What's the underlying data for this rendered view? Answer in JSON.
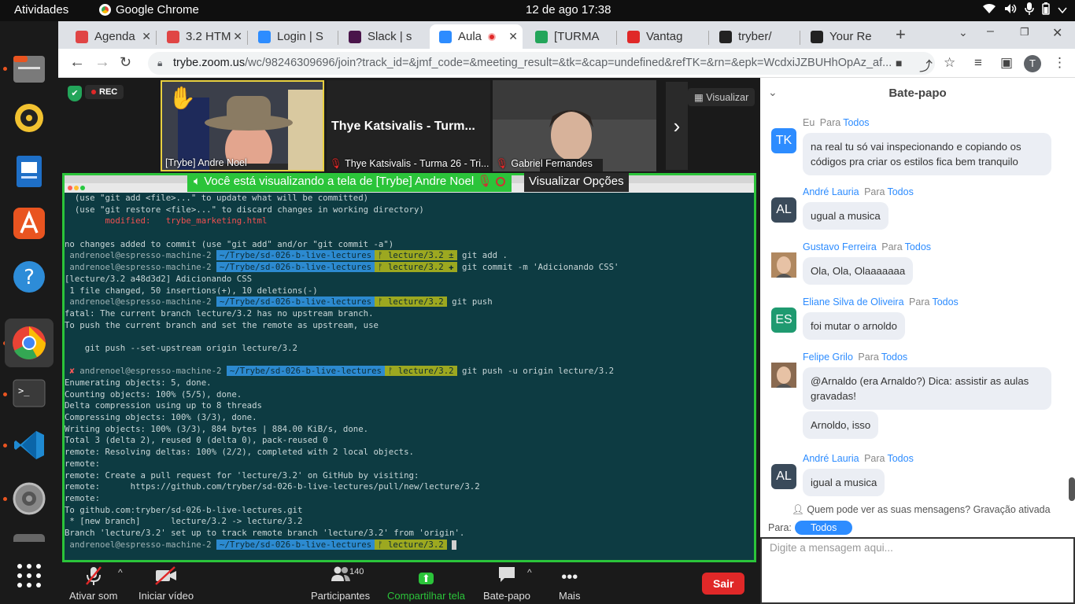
{
  "system": {
    "activities": "Atividades",
    "app_name": "Google Chrome",
    "clock": "12 de ago  17:38"
  },
  "browser": {
    "tabs": [
      {
        "label": "Agenda",
        "color": "#e04545"
      },
      {
        "label": "3.2 HTM",
        "color": "#e04545"
      },
      {
        "label": "Login | S",
        "color": "#2d8cff"
      },
      {
        "label": "Slack | s",
        "color": "#4a154b"
      },
      {
        "label": "Aula",
        "color": "#2d8cff"
      },
      {
        "label": "[TURMA",
        "color": "#23a55a"
      },
      {
        "label": "Vantag",
        "color": "#e02828"
      },
      {
        "label": "tryber/",
        "color": "#222222"
      },
      {
        "label": "Your Re",
        "color": "#222222"
      }
    ],
    "url_host": "trybe.zoom.us",
    "url_path": "/wc/98246309696/join?track_id=&jmf_code=&meeting_result=&tk=&cap=undefined&refTK=&rn=&epk=WcdxiJZBUHhOpAz_af...",
    "profile_initial": "T"
  },
  "meeting": {
    "rec_label": "REC",
    "visualizar_label": "Visualizar",
    "participants": [
      {
        "name": "[Trybe] Andre Noel"
      },
      {
        "name": "Thye Katsivalis - Turma 26 - Tri...",
        "big_label": "Thye Katsivalis - Turm..."
      },
      {
        "name": "Gabriel Fernandes"
      }
    ],
    "share_banner": "Você está visualizando a tela de [Trybe] Andre Noel",
    "view_options": "Visualizar Opções",
    "controls": {
      "mute": "Ativar som",
      "video": "Iniciar vídeo",
      "participants": "Participantes",
      "participants_count": "140",
      "share": "Compartilhar tela",
      "chat": "Bate-papo",
      "more": "Mais",
      "leave": "Sair"
    }
  },
  "terminal": {
    "lines": [
      {
        "text": "  (use \"git add <file>...\" to update what will be committed)"
      },
      {
        "text": "  (use \"git restore <file>...\" to discard changes in working directory)"
      },
      {
        "text": "        modified:   trybe_marketing.html",
        "style": "modified"
      },
      {
        "text": ""
      },
      {
        "text": "no changes added to commit (use \"git add\" and/or \"git commit -a\")"
      },
      {
        "prompt": true,
        "host": " andrenoel@espresso-machine-2 ",
        "path": "~/Trybe/sd-026-b-live-lectures",
        "branch": "ᚠ lecture/3.2 ±",
        "cmd": " git add ."
      },
      {
        "prompt": true,
        "host": " andrenoel@espresso-machine-2 ",
        "path": "~/Trybe/sd-026-b-live-lectures",
        "branch": "ᚠ lecture/3.2 ✚",
        "cmd": " git commit -m 'Adicionando CSS'"
      },
      {
        "text": "[lecture/3.2 a48d3d2] Adicionando CSS"
      },
      {
        "text": " 1 file changed, 50 insertions(+), 10 deletions(-)"
      },
      {
        "prompt": true,
        "host": " andrenoel@espresso-machine-2 ",
        "path": "~/Trybe/sd-026-b-live-lectures",
        "branch": "ᚠ lecture/3.2",
        "cmd": " git push"
      },
      {
        "text": "fatal: The current branch lecture/3.2 has no upstream branch."
      },
      {
        "text": "To push the current branch and set the remote as upstream, use"
      },
      {
        "text": ""
      },
      {
        "text": "    git push --set-upstream origin lecture/3.2"
      },
      {
        "text": ""
      },
      {
        "prompt": true,
        "error": true,
        "host": " andrenoel@espresso-machine-2 ",
        "path": "~/Trybe/sd-026-b-live-lectures",
        "branch": "ᚠ lecture/3.2",
        "cmd": " git push -u origin lecture/3.2"
      },
      {
        "text": "Enumerating objects: 5, done."
      },
      {
        "text": "Counting objects: 100% (5/5), done."
      },
      {
        "text": "Delta compression using up to 8 threads"
      },
      {
        "text": "Compressing objects: 100% (3/3), done."
      },
      {
        "text": "Writing objects: 100% (3/3), 884 bytes | 884.00 KiB/s, done."
      },
      {
        "text": "Total 3 (delta 2), reused 0 (delta 0), pack-reused 0"
      },
      {
        "text": "remote: Resolving deltas: 100% (2/2), completed with 2 local objects."
      },
      {
        "text": "remote:"
      },
      {
        "text": "remote: Create a pull request for 'lecture/3.2' on GitHub by visiting:"
      },
      {
        "text": "remote:      https://github.com/tryber/sd-026-b-live-lectures/pull/new/lecture/3.2"
      },
      {
        "text": "remote:"
      },
      {
        "text": "To github.com:tryber/sd-026-b-live-lectures.git"
      },
      {
        "text": " * [new branch]      lecture/3.2 -> lecture/3.2"
      },
      {
        "text": "Branch 'lecture/3.2' set up to track remote branch 'lecture/3.2' from 'origin'."
      },
      {
        "prompt": true,
        "cursor": true,
        "host": " andrenoel@espresso-machine-2 ",
        "path": "~/Trybe/sd-026-b-live-lectures",
        "branch": "ᚠ lecture/3.2",
        "cmd": " "
      }
    ]
  },
  "chat": {
    "title": "Bate-papo",
    "para": "Para",
    "messages": [
      {
        "sender": "Eu",
        "to": "Todos",
        "initials": "TK",
        "avatar_color": "#2d8cff",
        "bubbles": [
          "na real tu só vai inspecionando e copiando os códigos pra criar os estilos fica bem tranquilo"
        ],
        "self": true
      },
      {
        "sender": "André Lauria",
        "to": "Todos",
        "initials": "AL",
        "avatar_color": "#3a4a5a",
        "bubbles": [
          "ugual a musica"
        ]
      },
      {
        "sender": "Gustavo Ferreira",
        "to": "Todos",
        "initials": "",
        "avatar_color": "#b08860",
        "bubbles": [
          "Ola, Ola, Olaaaaaaa"
        ]
      },
      {
        "sender": "Eliane Silva de Oliveira",
        "to": "Todos",
        "initials": "ES",
        "avatar_color": "#1f9a70",
        "bubbles": [
          "foi mutar o arnoldo"
        ]
      },
      {
        "sender": "Felipe Grilo",
        "to": "Todos",
        "initials": "",
        "avatar_color": "#8a6a50",
        "bubbles": [
          "@Arnaldo (era Arnaldo?) Dica: assistir as aulas gravadas!",
          "Arnoldo, isso"
        ]
      },
      {
        "sender": "André Lauria",
        "to": "Todos",
        "initials": "AL",
        "avatar_color": "#3a4a5a",
        "bubbles": [
          "igual a musica"
        ]
      }
    ],
    "privacy_note": "Quem pode ver as suas mensagens? Gravação ativada",
    "to_label": "Para:",
    "to_value": "Todos",
    "input_placeholder": "Digite a mensagem aqui..."
  }
}
